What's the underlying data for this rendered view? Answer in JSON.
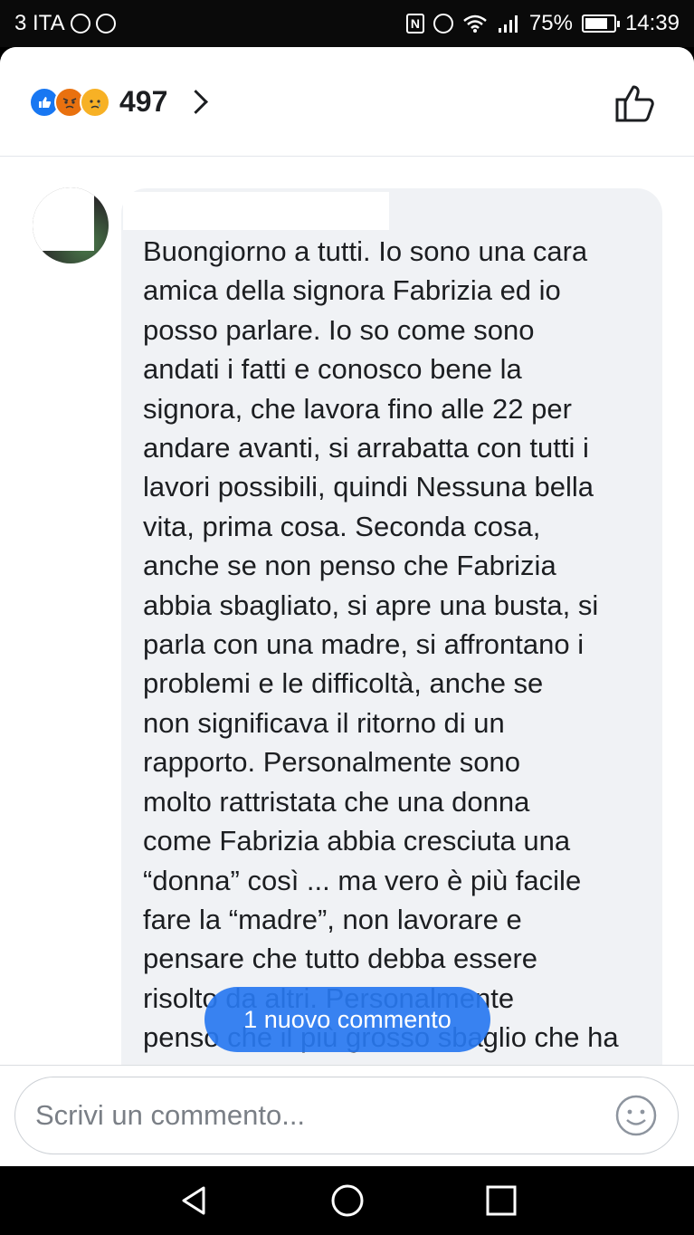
{
  "status_bar": {
    "carrier": "3 ITA",
    "battery": "75%",
    "time": "14:39"
  },
  "header": {
    "reaction_count": "497",
    "reactions": [
      "like-icon",
      "angry-icon",
      "sad-icon"
    ]
  },
  "comment": {
    "lines": [
      "Buongiorno a tutti. Io sono una cara",
      "amica della signora Fabrizia ed io",
      "posso parlare. Io so come sono",
      "andati i fatti e conosco bene la",
      "signora, che lavora fino alle 22 per",
      "andare avanti, si arrabatta con tutti i",
      "lavori possibili, quindi Nessuna bella",
      "vita, prima cosa. Seconda cosa,",
      "anche se non penso che Fabrizia",
      "abbia sbagliato, si apre una busta, si",
      "parla con una madre, si affrontano i",
      "problemi e le difficoltà, anche se",
      "non significava il ritorno di un",
      "rapporto. Personalmente sono",
      "molto rattristata che una donna",
      "come Fabrizia abbia cresciuta una",
      "“donna” così ... ma vero è più facile",
      "fare la “madre”, non lavorare e",
      "pensare che tutto debba essere",
      "risolto da altri. Personalmente",
      "penso che il più grosso sbaglio che ha"
    ]
  },
  "new_comment_pill": "1 nuovo commento",
  "composer": {
    "placeholder": "Scrivi un commento..."
  },
  "colors": {
    "accent": "#1877f2",
    "bubble": "#f0f2f5"
  }
}
